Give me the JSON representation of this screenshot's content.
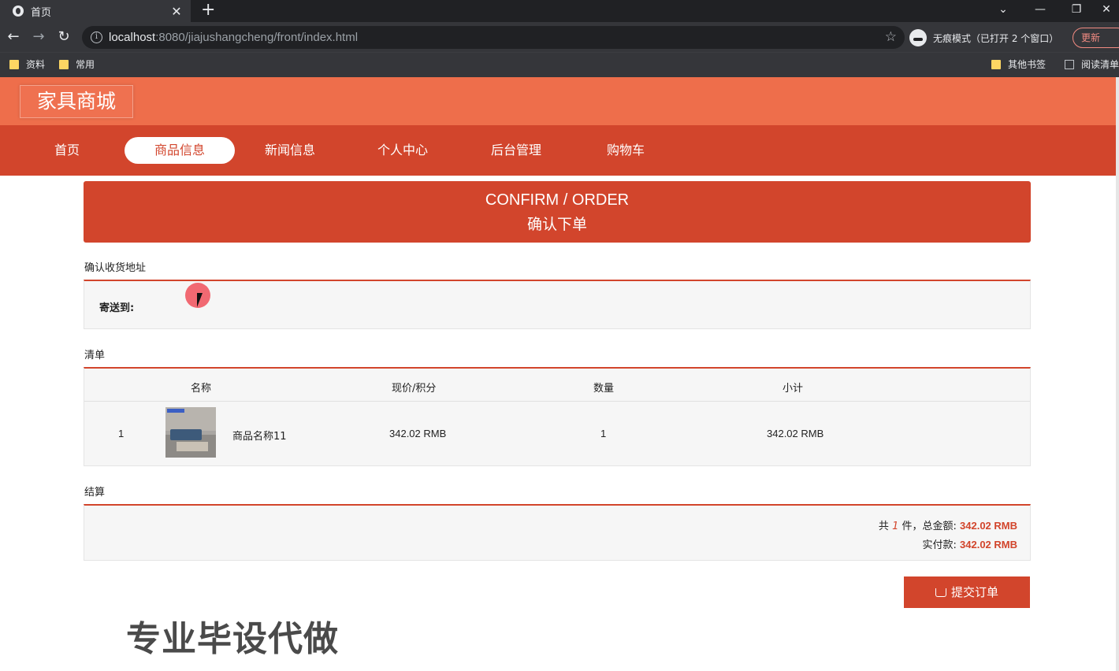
{
  "browser": {
    "tab_title": "首页",
    "url_host": "localhost",
    "url_rest": ":8080/jiajushangcheng/front/index.html",
    "incognito_label": "无痕模式（已打开 2 个窗口）",
    "update_label": "更新",
    "bookmarks": [
      "资料",
      "常用"
    ],
    "bookmarks_right": [
      "其他书签",
      "阅读清单"
    ]
  },
  "site": {
    "logo": "家具商城",
    "nav": [
      "首页",
      "商品信息",
      "新闻信息",
      "个人中心",
      "后台管理",
      "购物车"
    ],
    "active_nav": "商品信息"
  },
  "banner": {
    "title_en": "CONFIRM / ORDER",
    "title_cn": "确认下单"
  },
  "address": {
    "section_title": "确认收货地址",
    "ship_to_label": "寄送到:"
  },
  "list": {
    "section_title": "清单",
    "headers": [
      "名称",
      "现价/积分",
      "数量",
      "小计"
    ],
    "rows": [
      {
        "index": "1",
        "name": "商品名称11",
        "price": "342.02 RMB",
        "qty": "1",
        "subtotal": "342.02 RMB"
      }
    ]
  },
  "settlement": {
    "section_title": "结算",
    "count_prefix": "共",
    "count": "1",
    "count_suffix": "件，总金额:",
    "total": "342.02 RMB",
    "paid_label": "实付款:",
    "paid": "342.02 RMB"
  },
  "submit_label": "提交订单",
  "watermark": "专业毕设代做"
}
